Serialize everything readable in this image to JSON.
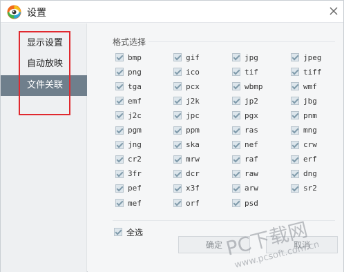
{
  "window": {
    "title": "设置"
  },
  "icons": {
    "app": "app-eye-logo-icon",
    "close": "close-icon",
    "check": "check-icon"
  },
  "colors": {
    "accent": "#6f7f8c",
    "highlight": "#e0292f",
    "checkbox_fill": "#dde6ec"
  },
  "sidebar": {
    "items": [
      {
        "label": "显示设置",
        "active": false
      },
      {
        "label": "自动放映",
        "active": false
      },
      {
        "label": "文件关联",
        "active": true
      }
    ]
  },
  "main": {
    "group_title": "格式选择",
    "formats": [
      "bmp",
      "gif",
      "jpg",
      "jpeg",
      "png",
      "ico",
      "tif",
      "tiff",
      "tga",
      "pcx",
      "wbmp",
      "wmf",
      "emf",
      "j2k",
      "jp2",
      "jbg",
      "j2c",
      "jpc",
      "pgx",
      "pnm",
      "pgm",
      "ppm",
      "ras",
      "mng",
      "jng",
      "ska",
      "nef",
      "crw",
      "cr2",
      "mrw",
      "raf",
      "erf",
      "3fr",
      "dcr",
      "raw",
      "dng",
      "pef",
      "x3f",
      "arw",
      "sr2",
      "mef",
      "orf",
      "psd"
    ],
    "select_all_label": "全选",
    "ok_label": "确定",
    "cancel_label": "取消"
  },
  "watermark": {
    "line1": "PC下载网",
    "line2": "www.pcsoft.com.cn"
  }
}
